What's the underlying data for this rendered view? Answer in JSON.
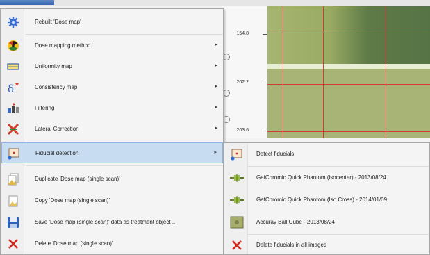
{
  "background": {
    "ruler_labels": [
      "154.8",
      "202.2",
      "203.6"
    ]
  },
  "main_menu": {
    "items": [
      {
        "label": "Rebuilt 'Dose map'",
        "icon": "gear-icon",
        "submenu": false
      },
      {
        "label": "Dose mapping method",
        "icon": "radiation-icon",
        "submenu": true
      },
      {
        "label": "Uniformity map",
        "icon": "uniformity-icon",
        "submenu": true
      },
      {
        "label": "Consistency map",
        "icon": "consistency-icon",
        "submenu": true
      },
      {
        "label": "Filtering",
        "icon": "filter-icon",
        "submenu": true
      },
      {
        "label": "Lateral Correction",
        "icon": "lateral-correction-icon",
        "submenu": true
      },
      {
        "label": "Fiducial detection",
        "icon": "fiducial-icon",
        "submenu": true
      },
      {
        "label": "Duplicate 'Dose map (single scan)'",
        "icon": "duplicate-icon",
        "submenu": false
      },
      {
        "label": "Copy 'Dose map (single scan)'",
        "icon": "copy-icon",
        "submenu": false
      },
      {
        "label": "Save 'Dose map (single scan)' data as treatment object ...",
        "icon": "save-icon",
        "submenu": false
      },
      {
        "label": "Delete 'Dose map (single scan)'",
        "icon": "delete-icon",
        "submenu": false
      }
    ],
    "arrow_glyph": "▸"
  },
  "sub_menu": {
    "items": [
      {
        "label": "Detect fiducials",
        "icon": "fiducial-icon"
      },
      {
        "label": "GafChromic Quick Phantom (isocenter) - 2013/08/24",
        "icon": "phantom-icon"
      },
      {
        "label": "GafChromic Quick Phantom (Iso Cross) - 2014/01/09",
        "icon": "phantom-icon"
      },
      {
        "label": "Accuray Ball Cube - 2013/08/24",
        "icon": "ball-cube-icon"
      },
      {
        "label": "Delete fiducials in all images",
        "icon": "delete-icon"
      }
    ]
  },
  "colors": {
    "highlight": "#c7dcf1",
    "grid_line": "#d43a3a",
    "film_green": "#9cad68"
  }
}
